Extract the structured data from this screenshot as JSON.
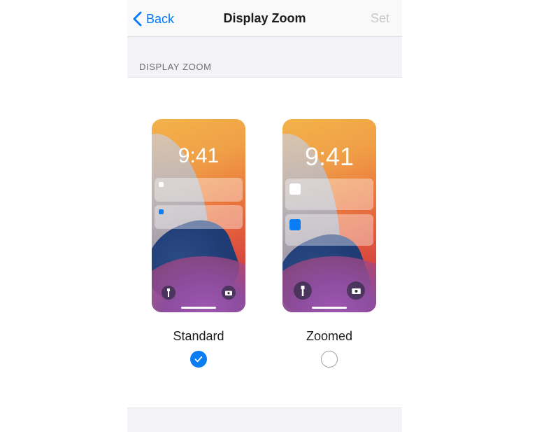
{
  "navbar": {
    "back_label": "Back",
    "title": "Display Zoom",
    "set_label": "Set"
  },
  "section": {
    "header": "DISPLAY ZOOM"
  },
  "options": [
    {
      "label": "Standard",
      "time": "9:41",
      "selected": true
    },
    {
      "label": "Zoomed",
      "time": "9:41",
      "selected": false
    }
  ],
  "colors": {
    "accent": "#007aff",
    "disabled": "#c7c7cc",
    "checkbox": "#0a7df5"
  },
  "icons": {
    "back": "chevron-left-icon",
    "check": "checkmark-icon",
    "flashlight": "flashlight-icon",
    "camera": "camera-icon"
  }
}
